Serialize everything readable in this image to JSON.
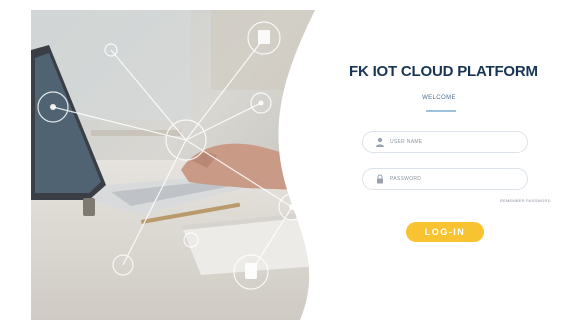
{
  "login": {
    "title": "FK IOT CLOUD PLATFORM",
    "subtitle": "WELCOME",
    "username_placeholder": "USER NAME",
    "password_placeholder": "PASSWORD",
    "remember_label": "REMEMBER PASSWORD",
    "login_label": "LOG-IN"
  },
  "icons": {
    "user": "user-icon",
    "lock": "lock-icon"
  },
  "colors": {
    "title": "#183653",
    "accent": "#f8c331",
    "divider": "#9dc0df"
  }
}
